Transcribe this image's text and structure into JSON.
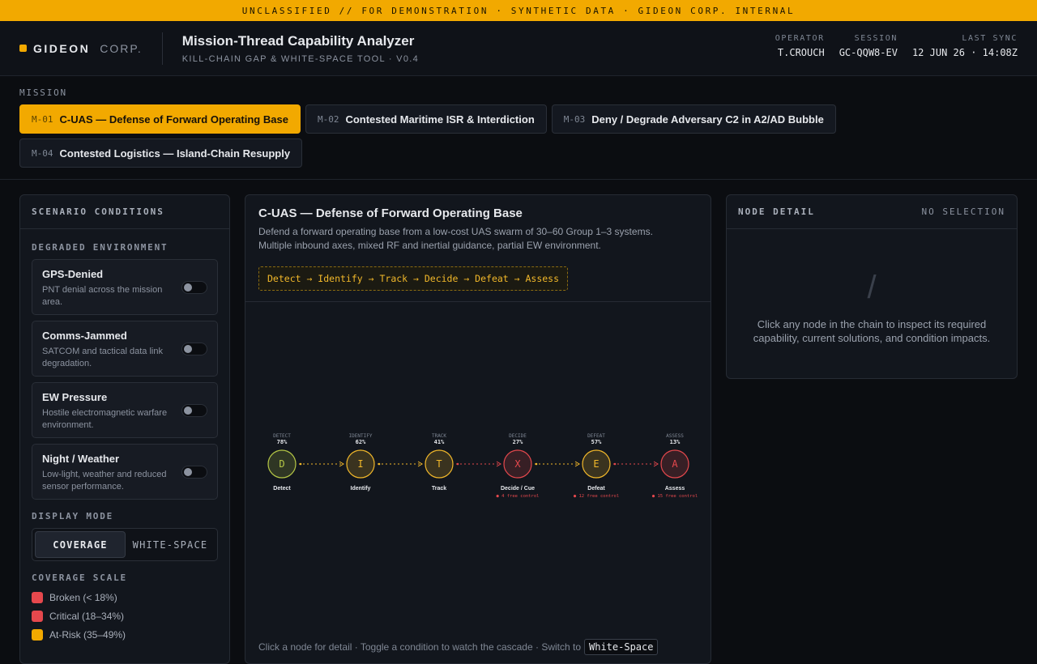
{
  "banner": "UNCLASSIFIED // FOR DEMONSTRATION · SYNTHETIC DATA · GIDEON CORP. INTERNAL",
  "brand": {
    "name": "GIDEON",
    "corp": "CORP."
  },
  "app": {
    "title": "Mission-Thread Capability Analyzer",
    "subtitle": "KILL-CHAIN GAP & WHITE-SPACE TOOL · V0.4"
  },
  "meta": [
    {
      "label": "OPERATOR",
      "value": "T.CROUCH"
    },
    {
      "label": "SESSION",
      "value": "GC-QQW8-EV"
    },
    {
      "label": "LAST SYNC",
      "value": "12 JUN 26 · 14:08Z"
    }
  ],
  "missions": {
    "label": "MISSION",
    "items": [
      {
        "id": "M-01",
        "name": "C-UAS — Defense of Forward Operating Base",
        "active": true
      },
      {
        "id": "M-02",
        "name": "Contested Maritime ISR & Interdiction",
        "active": false
      },
      {
        "id": "M-03",
        "name": "Deny / Degrade Adversary C2 in A2/AD Bubble",
        "active": false
      },
      {
        "id": "M-04",
        "name": "Contested Logistics — Island-Chain Resupply",
        "active": false
      }
    ]
  },
  "scenario": {
    "title": "SCENARIO CONDITIONS",
    "env_label": "DEGRADED ENVIRONMENT",
    "conditions": [
      {
        "name": "GPS-Denied",
        "desc": "PNT denial across the mission area.",
        "on": false
      },
      {
        "name": "Comms-Jammed",
        "desc": "SATCOM and tactical data link degradation.",
        "on": false
      },
      {
        "name": "EW Pressure",
        "desc": "Hostile electromagnetic warfare environment.",
        "on": false
      },
      {
        "name": "Night / Weather",
        "desc": "Low-light, weather and reduced sensor performance.",
        "on": false
      }
    ],
    "display_label": "DISPLAY MODE",
    "modes": [
      "COVERAGE",
      "WHITE-SPACE"
    ],
    "active_mode": "COVERAGE",
    "scale_label": "COVERAGE SCALE",
    "scale": [
      {
        "label": "Broken (< 18%)",
        "color": "#e5484d"
      },
      {
        "label": "Critical (18–34%)",
        "color": "#e5484d"
      },
      {
        "label": "At-Risk (35–49%)",
        "color": "#f2a900"
      }
    ]
  },
  "center": {
    "title": "C-UAS — Defense of Forward Operating Base",
    "desc": "Defend a forward operating base from a low-cost UAS swarm of 30–60 Group 1–3 systems. Multiple inbound axes, mixed RF and inertial guidance, partial EW environment.",
    "chain": "Detect → Identify → Track → Decide → Defeat → Assess",
    "footer": "Click a node for detail · Toggle a condition to watch the cascade · Switch to",
    "footer_kbd": "White-Space"
  },
  "chart_data": {
    "type": "flow",
    "nodes": [
      {
        "stage": "DETECT",
        "pct": 78,
        "letter": "D",
        "name": "Detect",
        "status": "ok",
        "note": ""
      },
      {
        "stage": "IDENTIFY",
        "pct": 62,
        "letter": "I",
        "name": "Identify",
        "status": "warn",
        "note": ""
      },
      {
        "stage": "TRACK",
        "pct": 41,
        "letter": "T",
        "name": "Track",
        "status": "warn",
        "note": ""
      },
      {
        "stage": "DECIDE",
        "pct": 27,
        "letter": "X",
        "name": "Decide / Cue",
        "status": "crit",
        "note": "● 4 free control"
      },
      {
        "stage": "DEFEAT",
        "pct": 57,
        "letter": "E",
        "name": "Defeat",
        "status": "warn",
        "note": "● 12 free control"
      },
      {
        "stage": "ASSESS",
        "pct": 13,
        "letter": "A",
        "name": "Assess",
        "status": "crit",
        "note": "● 15 free control"
      }
    ],
    "colors": {
      "ok": "#b6c846",
      "warn": "#f2b82a",
      "crit": "#e5484d"
    }
  },
  "detail": {
    "title": "NODE DETAIL",
    "state": "NO SELECTION",
    "icon": "/",
    "message": "Click any node in the chain to inspect its required capability, current solutions, and condition impacts."
  }
}
